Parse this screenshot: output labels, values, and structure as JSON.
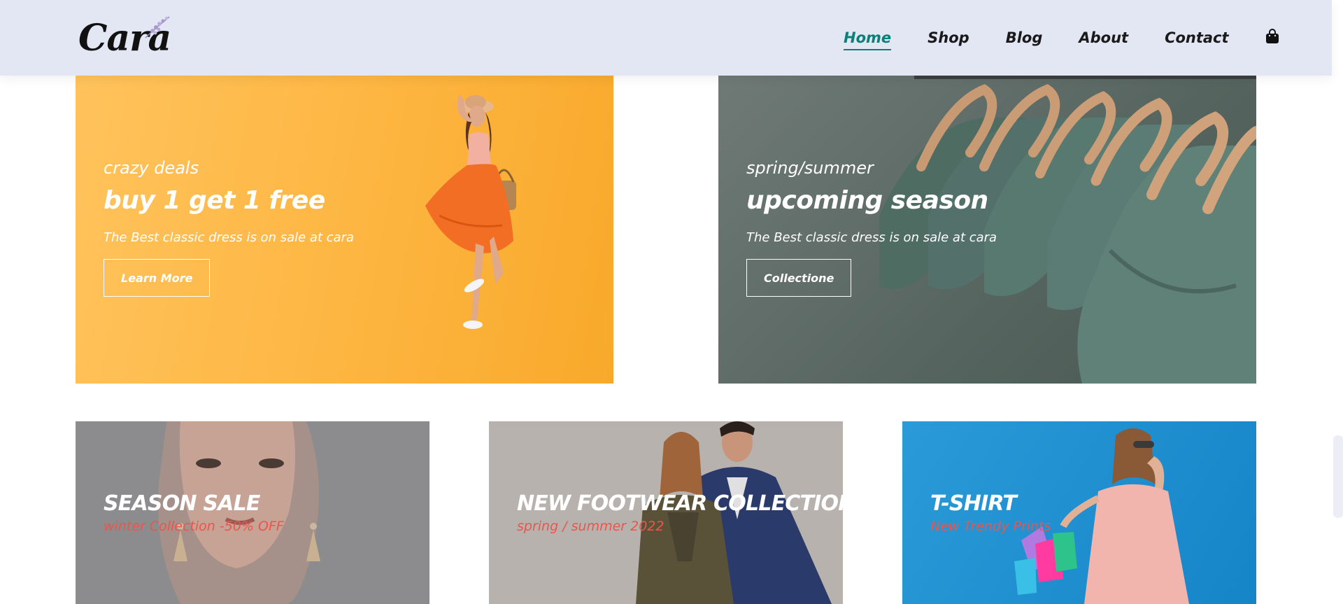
{
  "header": {
    "logo_text": "Cara",
    "nav": [
      {
        "label": "Home",
        "active": true
      },
      {
        "label": "Shop",
        "active": false
      },
      {
        "label": "Blog",
        "active": false
      },
      {
        "label": "About",
        "active": false
      },
      {
        "label": "Contact",
        "active": false
      }
    ],
    "cart_icon": "shopping-bag-icon"
  },
  "banners": {
    "deals": {
      "small": "crazy deals",
      "big": "buy 1 get 1 free",
      "desc": "The Best classic dress is on sale at cara",
      "button": "Learn More",
      "bg_color": "#fbb53b"
    },
    "season": {
      "small": "spring/summer",
      "big": "upcoming season",
      "desc": "The Best classic dress is on sale at cara",
      "button": "Collectione",
      "bg_color": "#5c6e68"
    }
  },
  "small_banners": [
    {
      "title": "SEASON SALE",
      "subtitle": "winter Collection -50% OFF",
      "bg_color": "#8c8b8d"
    },
    {
      "title": "NEW FOOTWEAR COLLECTION",
      "subtitle": "spring / summer 2022",
      "bg_color": "#b7b2ae"
    },
    {
      "title": "T-SHIRT",
      "subtitle": "New Trendy Prints",
      "bg_color": "#1e8fd1"
    }
  ],
  "colors": {
    "header_bg": "#e3e6f3",
    "accent": "#088178",
    "subtitle_red": "#ec544e"
  }
}
